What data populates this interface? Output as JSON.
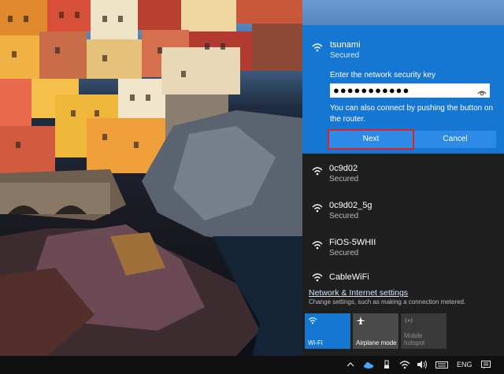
{
  "flyout": {
    "expanded_network": {
      "name": "tsunami",
      "status": "Secured",
      "key_label": "Enter the network security key",
      "key_value": "●●●●●●●●●●●",
      "hint": "You can also connect by pushing the button on the router.",
      "next_label": "Next",
      "cancel_label": "Cancel"
    },
    "networks": [
      {
        "name": "0c9d02",
        "status": "Secured"
      },
      {
        "name": "0c9d02_5g",
        "status": "Secured"
      },
      {
        "name": "FiOS-5WHII",
        "status": "Secured"
      },
      {
        "name": "CableWiFi",
        "status": ""
      }
    ],
    "settings_link": "Network & Internet settings",
    "settings_sub": "Change settings, such as making a connection metered.",
    "quick_actions": [
      {
        "label": "Wi-Fi",
        "icon": "wifi-icon"
      },
      {
        "label": "Airplane mode",
        "icon": "airplane-icon"
      },
      {
        "label": "Mobile hotspot",
        "icon": "hotspot-icon"
      }
    ]
  },
  "taskbar": {
    "language": "ENG",
    "tray_icons": [
      "chevron-up-icon",
      "onedrive-icon",
      "usb-icon",
      "wifi-icon",
      "volume-icon",
      "keyboard-icon",
      "notification-icon"
    ]
  },
  "colors": {
    "accent": "#1677d2",
    "flyout_bg": "#1f1f1f",
    "highlight_outline": "#e0202a",
    "taskbar_bg": "#101010"
  }
}
